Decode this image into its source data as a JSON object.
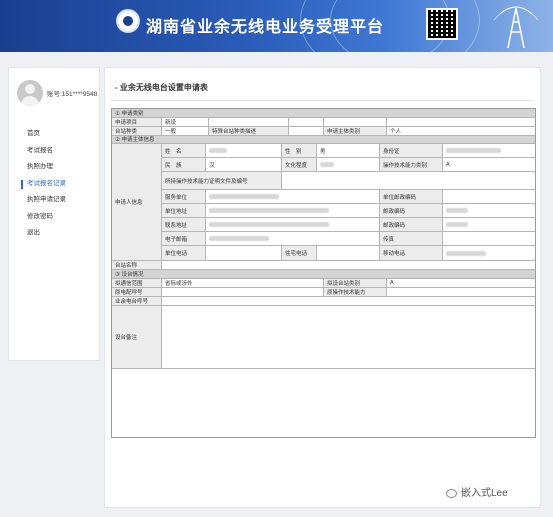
{
  "header": {
    "title": "湖南省业余无线电业务受理平台"
  },
  "sidebar": {
    "user_label": "账号:151****9548",
    "menu": [
      "首页",
      "考试报名",
      "执照办理",
      "考试报名记录",
      "执照申请记录",
      "修改密码",
      "退出"
    ],
    "active_index": 3
  },
  "form": {
    "title": "- 业余无线电台设置申请表",
    "section1": {
      "header": "① 申请类别",
      "project_label": "申请项目",
      "project_value": "新设",
      "station_type_label": "台站种类",
      "station_type_value": "一般",
      "special_desc_label": "特殊台站种类描述",
      "subject_type_label": "申请主体类别",
      "subject_type_value": "个人"
    },
    "section2": {
      "header": "② 申请主体信息",
      "group_label": "申请人信息",
      "name_label": "姓　名",
      "gender_label": "性　别",
      "gender_value": "男",
      "id_label": "身份证",
      "ethnicity_label": "民　族",
      "ethnicity_value": "汉",
      "education_label": "文化程度",
      "op_class_label": "操作技术能力类别",
      "op_class_value": "A",
      "cert_label": "所持操作技术能力证明文件及编号",
      "work_unit_label": "服务单位",
      "unit_postcode_label": "单位邮政编码",
      "unit_address_label": "单位地址",
      "postcode_label": "邮政编码",
      "contact_address_label": "联系地址",
      "postcode2_label": "邮政编码",
      "email_label": "电子邮箱",
      "fax_label": "传真",
      "unit_phone_label": "单位电话",
      "home_phone_label": "住宅电话",
      "mobile_label": "移动电话",
      "station_name_label": "台站名称"
    },
    "section3": {
      "header": "③ 设台情况",
      "range_label": "拟通信范围",
      "range_value": "省际或涉外",
      "proposed_class_label": "拟设台站类别",
      "proposed_class_value": "A",
      "orig_callsign_label": "原电配呼号",
      "orig_op_label": "原操作技术能力",
      "callsign_label": "业余电台呼号",
      "remarks_label": "设台备注"
    }
  },
  "watermark": "嵌入式Lee"
}
